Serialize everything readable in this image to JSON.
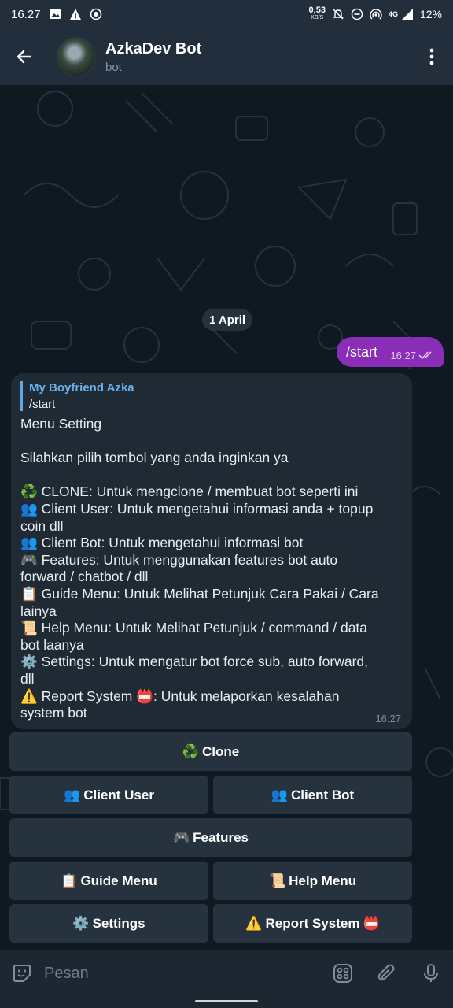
{
  "status_bar": {
    "time": "16.27",
    "net_speed": "0,53",
    "net_unit": "KB/S",
    "network": "4G",
    "battery": "12%"
  },
  "header": {
    "title": "AzkaDev Bot",
    "subtitle": "bot"
  },
  "chat": {
    "date": "1 April",
    "outgoing": {
      "text": "/start",
      "time": "16:27"
    },
    "incoming": {
      "reply_name": "My Boyfriend Azka",
      "reply_text": "/start",
      "lines": [
        "Menu Setting",
        "",
        "Silahkan pilih tombol yang anda inginkan ya",
        "",
        "♻️ CLONE: Untuk mengclone / membuat bot seperti ini",
        "👥 Client User: Untuk mengetahui informasi anda + topup",
        "coin dll",
        "👥 Client Bot: Untuk mengetahui informasi bot",
        "🎮 Features: Untuk menggunakan features bot auto",
        "forward / chatbot / dll",
        "📋 Guide Menu: Untuk Melihat Petunjuk Cara Pakai / Cara",
        "lainya",
        "📜 Help Menu: Untuk Melihat Petunjuk / command / data",
        "bot laanya",
        "⚙️ Settings: Untuk mengatur bot force sub, auto forward,",
        "dll",
        "⚠️ Report System 📛: Untuk melaporkan kesalahan",
        "system bot"
      ],
      "time": "16:27"
    }
  },
  "keyboard": {
    "clone": {
      "icon": "♻️",
      "label": "Clone"
    },
    "client_user": {
      "icon": "👥",
      "label": "Client User"
    },
    "client_bot": {
      "icon": "👥",
      "label": "Client Bot"
    },
    "features": {
      "icon": "🎮",
      "label": "Features"
    },
    "guide_menu": {
      "icon": "📋",
      "label": "Guide Menu"
    },
    "help_menu": {
      "icon": "📜",
      "label": "Help Menu"
    },
    "settings": {
      "icon": "⚙️",
      "label": "Settings"
    },
    "report_system": {
      "icon": "⚠️",
      "label": "Report System",
      "suffix": "📛"
    }
  },
  "input": {
    "placeholder": "Pesan"
  },
  "colors": {
    "header_bg": "#232e3c",
    "chat_bg": "#0f1922",
    "outgoing_bubble": "#8a2eb8",
    "incoming_bubble": "#1f2a35",
    "button_bg": "#26333f",
    "accent": "#6aaeea"
  }
}
